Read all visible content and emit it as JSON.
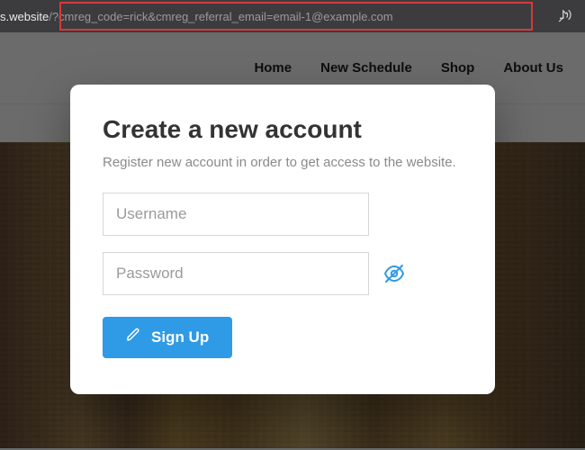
{
  "browser": {
    "url_prefix": "s.website",
    "url_rest": "/?cmreg_code=rick&cmreg_referral_email=email-1@example.com",
    "read_aloud_icon": "read-aloud"
  },
  "nav": {
    "items": [
      "Home",
      "New Schedule",
      "Shop",
      "About Us"
    ]
  },
  "modal": {
    "title": "Create a new account",
    "subtitle": "Register new account in order to get access to the website.",
    "username_placeholder": "Username",
    "password_placeholder": "Password",
    "signup_label": "Sign Up"
  }
}
